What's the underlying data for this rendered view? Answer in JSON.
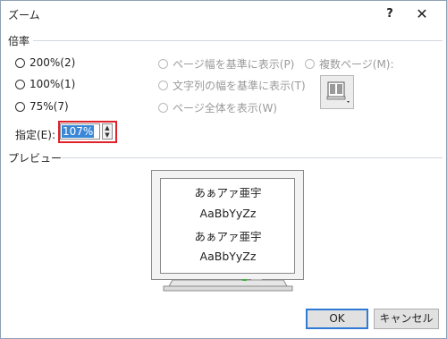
{
  "title": "ズーム",
  "titlebar": {
    "help": "?",
    "close": "✕"
  },
  "zoom_section": {
    "label": "倍率",
    "radios_left": [
      {
        "label": "200%(2)"
      },
      {
        "label": "100%(1)"
      },
      {
        "label": "75%(7)"
      }
    ],
    "radios_middle": [
      {
        "label": "ページ幅を基準に表示(P)"
      },
      {
        "label": "文字列の幅を基準に表示(T)"
      },
      {
        "label": "ページ全体を表示(W)"
      }
    ],
    "multi_page": {
      "label": "複数ページ(M):",
      "icon": "multi-page-icon"
    },
    "percent": {
      "label": "指定(E):",
      "value": "107%"
    }
  },
  "preview_section": {
    "label": "プレビュー",
    "lines": [
      "あぁアァ亜宇",
      "AaBbYyZz",
      "あぁアァ亜宇",
      "AaBbYyZz"
    ]
  },
  "buttons": {
    "ok": "OK",
    "cancel": "キャンセル"
  },
  "colors": {
    "highlight_border": "#e0222a",
    "selection": "#3a87d8"
  }
}
